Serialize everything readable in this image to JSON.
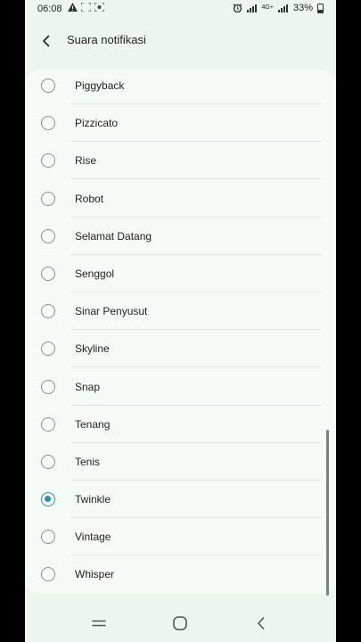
{
  "status_bar": {
    "time": "06:08",
    "battery": "33%",
    "network": "4G+"
  },
  "header": {
    "title": "Suara notifikasi"
  },
  "sounds": [
    {
      "label": "Piggyback",
      "selected": false
    },
    {
      "label": "Pizzicato",
      "selected": false
    },
    {
      "label": "Rise",
      "selected": false
    },
    {
      "label": "Robot",
      "selected": false
    },
    {
      "label": "Selamat Datang",
      "selected": false
    },
    {
      "label": "Senggol",
      "selected": false
    },
    {
      "label": "Sinar Penyusut",
      "selected": false
    },
    {
      "label": "Skyline",
      "selected": false
    },
    {
      "label": "Snap",
      "selected": false
    },
    {
      "label": "Tenang",
      "selected": false
    },
    {
      "label": "Tenis",
      "selected": false
    },
    {
      "label": "Twinkle",
      "selected": true
    },
    {
      "label": "Vintage",
      "selected": false
    },
    {
      "label": "Whisper",
      "selected": false
    }
  ],
  "colors": {
    "accent": "#2e8fb4",
    "background": "#eef4ee",
    "card": "#f6faf6"
  }
}
